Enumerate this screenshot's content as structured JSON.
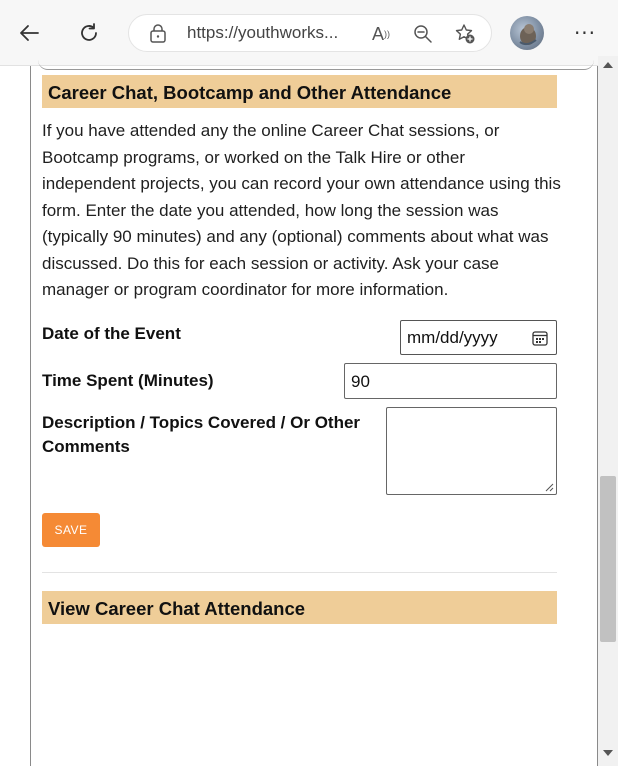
{
  "browser": {
    "url": "https://youthworks...",
    "icons": {
      "back": "arrow-left-icon",
      "refresh": "refresh-icon",
      "lock": "lock-icon",
      "read_aloud": "read-aloud-icon",
      "zoom": "zoom-out-icon",
      "favorite": "favorite-add-icon",
      "avatar": "profile-avatar",
      "menu": "more-menu-icon"
    },
    "read_aloud_glyph": "A",
    "menu_glyph": "···"
  },
  "form": {
    "section_title": "Career Chat, Bootcamp and Other Attendance",
    "intro": "If you have attended any the online Career Chat sessions, or Bootcamp programs, or worked on the Talk Hire or other independent projects, you can record your own attendance using this form. Enter the date you attended, how long the session was (typically 90 minutes) and any (optional) comments about what was discussed. Do this for each session or activity. Ask your case manager or program coordinator for more information.",
    "date_label": "Date of the Event",
    "date_placeholder": "mm/dd/yyyy",
    "time_label": "Time Spent (Minutes)",
    "time_value": "90",
    "description_label": "Description / Topics Covered / Or Other Comments",
    "description_value": "",
    "save_label": "SAVE"
  },
  "view_section": {
    "title": "View Career Chat Attendance"
  },
  "colors": {
    "header_bg": "#efcd98",
    "save_button": "#f58a35"
  }
}
